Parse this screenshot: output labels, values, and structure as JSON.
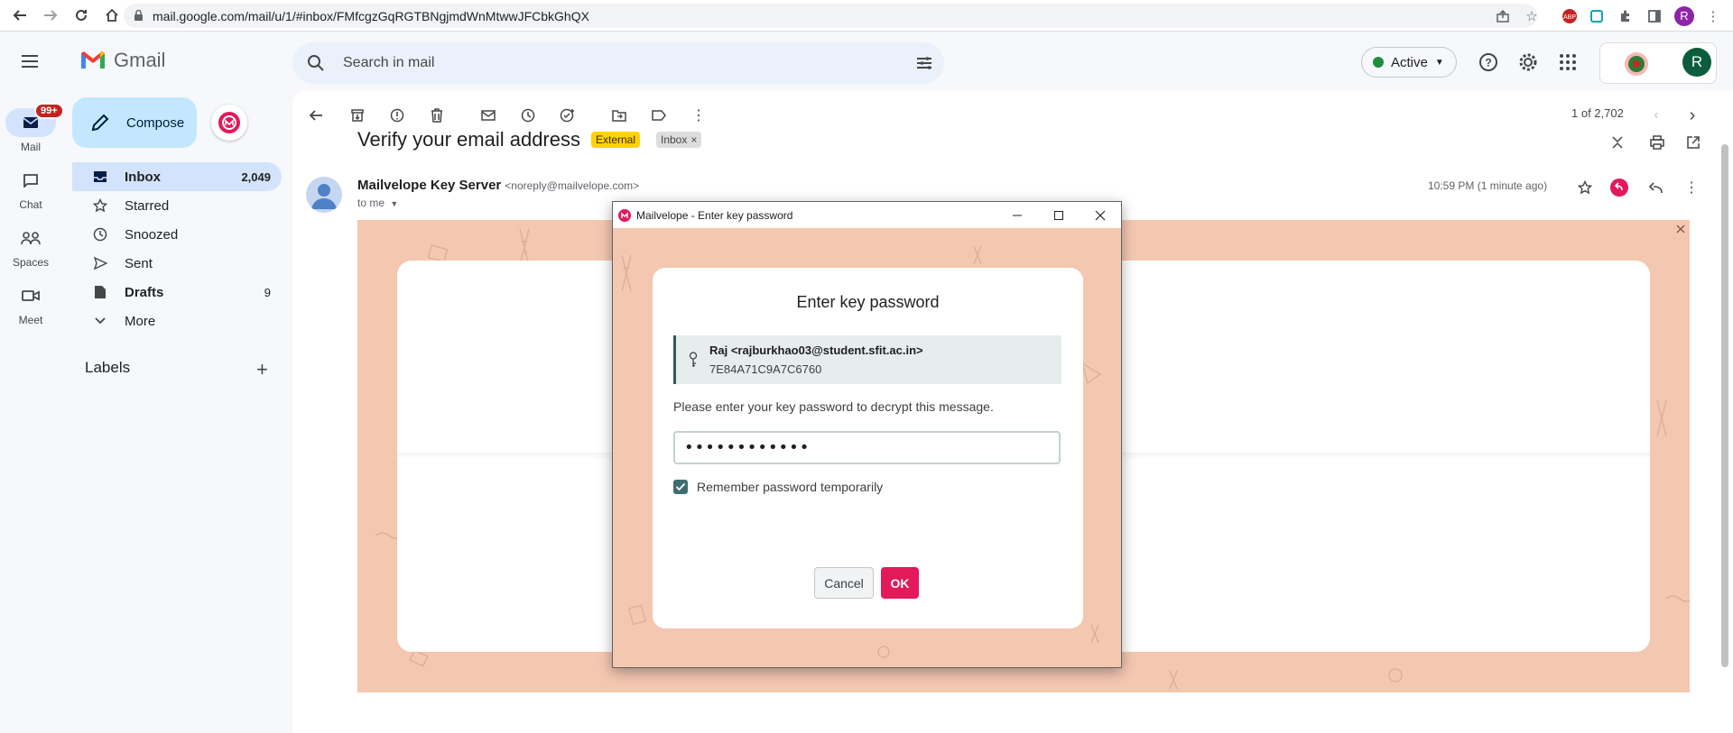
{
  "browser": {
    "url": "mail.google.com/mail/u/1/#inbox/FMfcgzGqRGTBNgjmdWnMtwwJFCbkGhQX"
  },
  "gmail": {
    "logo_text": "Gmail",
    "search_placeholder": "Search in mail",
    "status_label": "Active",
    "avatar_initial": "R"
  },
  "rail": {
    "mail_label": "Mail",
    "mail_badge": "99+",
    "chat_label": "Chat",
    "spaces_label": "Spaces",
    "meet_label": "Meet"
  },
  "sidebar": {
    "compose_label": "Compose",
    "items": [
      {
        "label": "Inbox",
        "count": "2,049"
      },
      {
        "label": "Starred",
        "count": ""
      },
      {
        "label": "Snoozed",
        "count": ""
      },
      {
        "label": "Sent",
        "count": ""
      },
      {
        "label": "Drafts",
        "count": "9"
      },
      {
        "label": "More",
        "count": ""
      }
    ],
    "labels_heading": "Labels"
  },
  "message": {
    "pager": "1 of 2,702",
    "subject": "Verify your email address",
    "tags": [
      "External",
      "Inbox"
    ],
    "sender_name": "Mailvelope Key Server",
    "sender_email": "<noreply@mailvelope.com>",
    "to_line": "to me",
    "time": "10:59 PM (1 minute ago)"
  },
  "popup": {
    "window_title": "Mailvelope - Enter key password",
    "dialog_title": "Enter key password",
    "key_user": "Raj <rajburkhao03@student.sfit.ac.in>",
    "key_id": "7E84A71C9A7C6760",
    "message": "Please enter your key password to decrypt this message.",
    "password_value": "••••••••••••",
    "remember_label": "Remember password temporarily",
    "remember_checked": true,
    "cancel_label": "Cancel",
    "ok_label": "OK"
  },
  "colors": {
    "accent": "#e2195a",
    "nav_active": "#d3e3fd",
    "compose_bg": "#c2e7ff",
    "popup_bg": "#f4c7b1"
  }
}
